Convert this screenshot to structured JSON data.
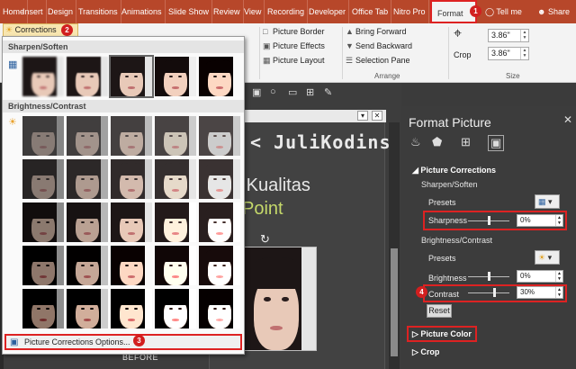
{
  "ribbon": {
    "tabs": [
      "Home",
      "Insert",
      "Design",
      "Transitions",
      "Animations",
      "Slide Show",
      "Review",
      "View",
      "Recording",
      "Developer",
      "Office Tab",
      "Nitro Pro"
    ],
    "active_tab": "Format",
    "tell_me": "Tell me",
    "share": "Share",
    "corrections_label": "Corrections",
    "picture_border": "Picture Border",
    "picture_effects": "Picture Effects",
    "picture_layout": "Picture Layout",
    "bring_forward": "Bring Forward",
    "send_backward": "Send Backward",
    "selection_pane": "Selection Pane",
    "arrange_label": "Arrange",
    "crop_label": "Crop",
    "height_value": "3.86\"",
    "width_value": "3.86\"",
    "size_label": "Size"
  },
  "corrections_panel": {
    "sharpen_header": "Sharpen/Soften",
    "brightness_header": "Brightness/Contrast",
    "options_label": "Picture Corrections Options..."
  },
  "slide": {
    "title_line1": "n Kualitas",
    "title_line2": "Point",
    "caption": "BEFORE"
  },
  "watermark": "< JuliKodins />",
  "format_pane": {
    "title": "Format Picture",
    "section_corrections": "Picture Corrections",
    "sharpen_soften": "Sharpen/Soften",
    "presets_label": "Presets",
    "sharpness_label": "Sharpness",
    "sharpness_value": "0%",
    "brightness_contrast": "Brightness/Contrast",
    "presets_label_2": "Presets",
    "brightness_label": "Brightness",
    "brightness_value": "0%",
    "contrast_label": "Contrast",
    "contrast_value": "30%",
    "reset_label": "Reset",
    "section_picture_color": "Picture Color",
    "section_crop": "Crop"
  },
  "callouts": [
    "1",
    "2",
    "3",
    "4"
  ],
  "colors": {
    "ribbon_accent": "#b7472a",
    "highlight_red": "#d22222",
    "pane_bg": "#3c3c3c"
  },
  "icons": [
    "lightbulb-icon",
    "person-icon",
    "sun-icon",
    "grid-icon",
    "picture-icon",
    "effects-icon",
    "layout-icon",
    "paint-bucket-icon",
    "pentagon-icon",
    "size-icon",
    "close-icon",
    "rotate-icon"
  ],
  "levels": {
    "sharpness_fraction": 0.5,
    "brightness_fraction": 0.5,
    "contrast_fraction": 0.65
  }
}
